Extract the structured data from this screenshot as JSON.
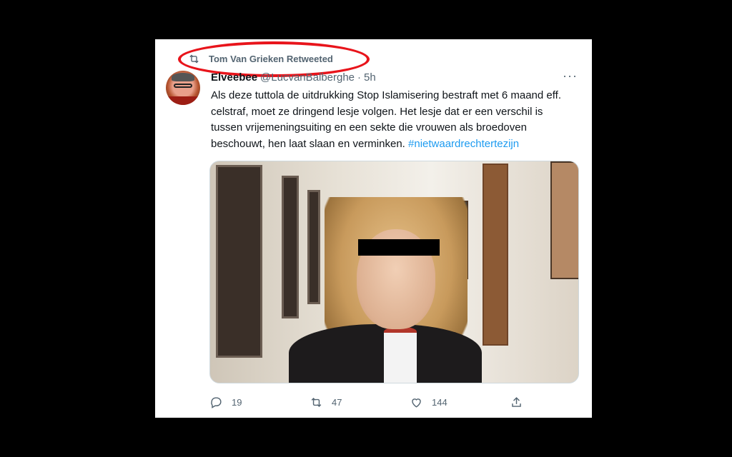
{
  "retweet": {
    "by_text": "Tom Van Grieken Retweeted"
  },
  "tweet": {
    "author_name": "Elveebee",
    "handle": "@LucvanBalberghe",
    "separator": "·",
    "time": "5h",
    "text_lines": [
      "Als deze tuttola de uitdrukking Stop Islamisering bestraft met 6 maand eff.",
      "celstraf, moet ze dringend lesje volgen. Het lesje dat er een verschil is",
      "tussen vrijemeningsuiting en een sekte die vrouwen als broedoven",
      "beschouwt, hen laat slaan en verminken."
    ],
    "hashtag": "#nietwaardrechtertezijn",
    "more_label": "···"
  },
  "actions": {
    "replies": "19",
    "retweets": "47",
    "likes": "144"
  },
  "colors": {
    "text": "#0f1419",
    "secondary": "#536471",
    "link": "#1d9bf0",
    "highlight": "#e8141b"
  },
  "icons": {
    "retweet": "retweet-icon",
    "reply": "reply-icon",
    "like": "heart-icon",
    "share": "share-icon",
    "more": "more-icon"
  }
}
